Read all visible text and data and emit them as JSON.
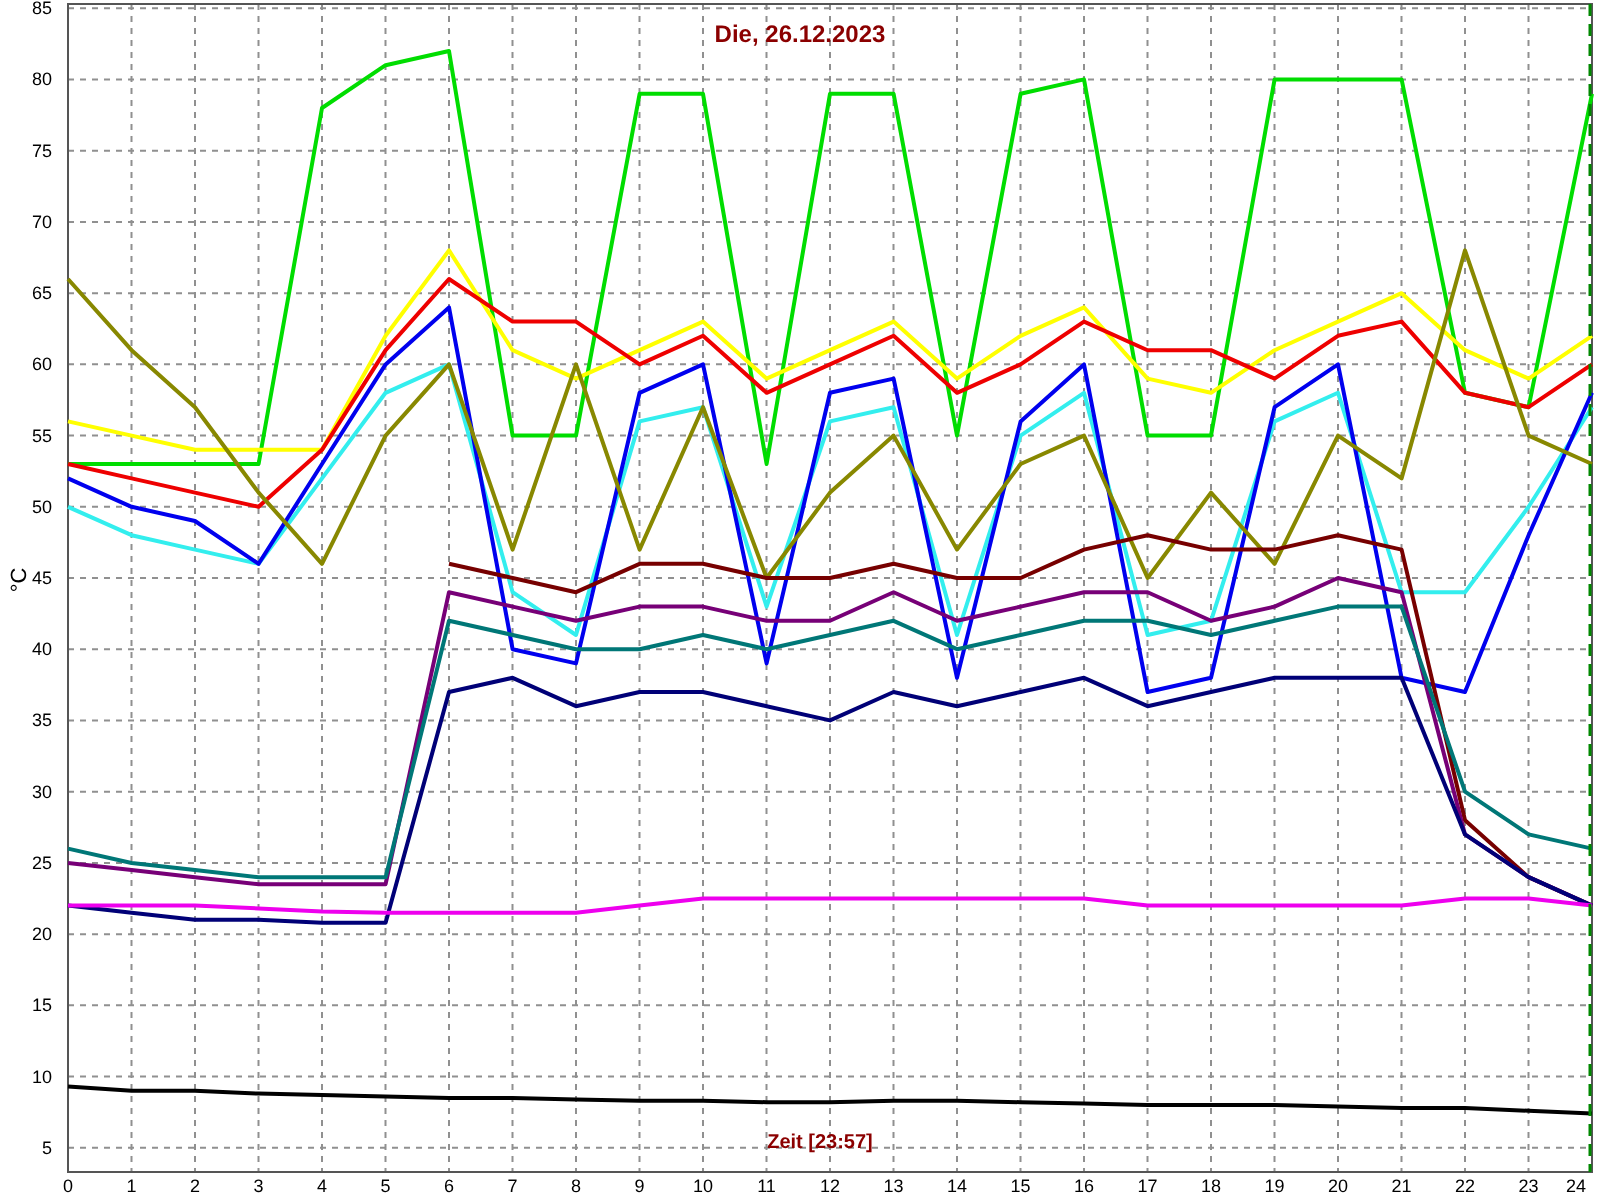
{
  "chart": {
    "chart_data": {
      "type": "line",
      "title": "Die, 26.12.2023",
      "xlabel": "Zeit [23:57]",
      "ylabel": "°C",
      "x": [
        0,
        1,
        2,
        3,
        4,
        5,
        6,
        7,
        8,
        9,
        10,
        11,
        12,
        13,
        14,
        15,
        16,
        17,
        18,
        19,
        20,
        21,
        22,
        23,
        24
      ],
      "grid": true,
      "xlim": [
        0,
        24
      ],
      "ylim": [
        3.3,
        85.3
      ],
      "xticks": [
        0,
        1,
        2,
        3,
        4,
        5,
        6,
        7,
        8,
        9,
        10,
        11,
        12,
        13,
        14,
        15,
        16,
        17,
        18,
        19,
        20,
        21,
        22,
        23,
        24
      ],
      "yticks": [
        5,
        10,
        15,
        20,
        25,
        30,
        35,
        40,
        45,
        50,
        55,
        60,
        65,
        70,
        75,
        80,
        85
      ],
      "series": [
        {
          "color": "#00dd00",
          "values": [
            53,
            53,
            53,
            53,
            78,
            81,
            82,
            55,
            55,
            79,
            79,
            53,
            79,
            79,
            55,
            79,
            80,
            55,
            55,
            80,
            80,
            80,
            58,
            57,
            79
          ]
        },
        {
          "color": "#ffff00",
          "values": [
            56,
            55,
            54,
            54,
            54,
            62,
            68,
            61,
            59,
            61,
            63,
            59,
            61,
            63,
            59,
            62,
            64,
            59,
            58,
            61,
            63,
            65,
            61,
            59,
            62
          ]
        },
        {
          "color": "#ee0000",
          "values": [
            53,
            52,
            51,
            50,
            54,
            61,
            66,
            63,
            63,
            60,
            62,
            58,
            60,
            62,
            58,
            60,
            63,
            61,
            61,
            59,
            62,
            63,
            58,
            57,
            60
          ]
        },
        {
          "color": "#33eeee",
          "values": [
            50,
            48,
            47,
            46,
            52,
            58,
            60,
            44,
            41,
            56,
            57,
            43,
            56,
            57,
            41,
            55,
            58,
            41,
            42,
            56,
            58,
            44,
            44,
            50,
            57
          ]
        },
        {
          "color": "#0000ee",
          "values": [
            52,
            50,
            49,
            46,
            53,
            60,
            64,
            40,
            39,
            58,
            60,
            39,
            58,
            59,
            38,
            56,
            60,
            37,
            38,
            57,
            60,
            38,
            37,
            48,
            58
          ]
        },
        {
          "color": "#888800",
          "values": [
            66,
            61,
            57,
            51,
            46,
            55,
            60,
            47,
            60,
            47,
            57,
            45,
            51,
            55,
            47,
            53,
            55,
            45,
            51,
            46,
            55,
            52,
            68,
            55,
            53
          ]
        },
        {
          "color": "#770000",
          "values": [
            null,
            null,
            null,
            null,
            null,
            null,
            46,
            45,
            44,
            46,
            46,
            45,
            45,
            46,
            45,
            45,
            47,
            48,
            47,
            47,
            48,
            47,
            28,
            24,
            22
          ]
        },
        {
          "color": "#770077",
          "values": [
            25,
            24.5,
            24,
            23.5,
            23.5,
            23.5,
            44,
            43,
            42,
            43,
            43,
            42,
            42,
            44,
            42,
            43,
            44,
            44,
            42,
            43,
            45,
            44,
            27,
            24,
            22
          ]
        },
        {
          "color": "#007777",
          "values": [
            26,
            25,
            24.5,
            24,
            24,
            24,
            42,
            41,
            40,
            40,
            41,
            40,
            41,
            42,
            40,
            41,
            42,
            42,
            41,
            42,
            43,
            43,
            30,
            27,
            26
          ]
        },
        {
          "color": "#000077",
          "values": [
            22,
            21.5,
            21,
            21,
            20.8,
            20.8,
            37,
            38,
            36,
            37,
            37,
            36,
            35,
            37,
            36,
            37,
            38,
            36,
            37,
            38,
            38,
            38,
            27,
            24,
            22
          ]
        },
        {
          "color": "#ee00ee",
          "values": [
            22,
            22,
            22,
            21.8,
            21.6,
            21.5,
            21.5,
            21.5,
            21.5,
            22,
            22.5,
            22.5,
            22.5,
            22.5,
            22.5,
            22.5,
            22.5,
            22,
            22,
            22,
            22,
            22,
            22.5,
            22.5,
            22
          ]
        },
        {
          "color": "#000000",
          "values": [
            9.3,
            9,
            9,
            8.8,
            8.7,
            8.6,
            8.5,
            8.5,
            8.4,
            8.3,
            8.3,
            8.2,
            8.2,
            8.3,
            8.3,
            8.2,
            8.1,
            8,
            8,
            8,
            7.9,
            7.8,
            7.8,
            7.6,
            7.4
          ]
        }
      ]
    }
  }
}
